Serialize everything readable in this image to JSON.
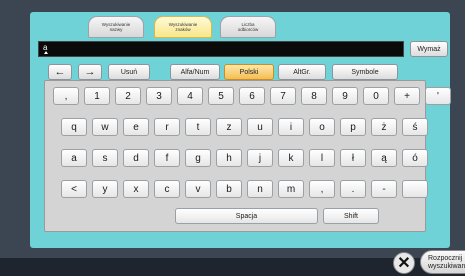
{
  "tabs": [
    {
      "line1": "Wyszukiwanie",
      "line2": "nazwy"
    },
    {
      "line1": "Wyszukiwanie",
      "line2": "znaków"
    },
    {
      "line1": "Liczba",
      "line2": "odbiorców"
    }
  ],
  "search": {
    "value": "a"
  },
  "clear_label": "Wymaż",
  "toolbar": {
    "left_arrow": "←",
    "right_arrow": "→",
    "delete": "Usuń",
    "alfanum": "Alfa/Num",
    "polski": "Polski",
    "altgr": "AltGr.",
    "symbols": "Symbole"
  },
  "keys": {
    "row1": [
      ",",
      "1",
      "2",
      "3",
      "4",
      "5",
      "6",
      "7",
      "8",
      "9",
      "0",
      "+",
      "'"
    ],
    "row2": [
      "q",
      "w",
      "e",
      "r",
      "t",
      "z",
      "u",
      "i",
      "o",
      "p",
      "ż",
      "ś"
    ],
    "row3": [
      "a",
      "s",
      "d",
      "f",
      "g",
      "h",
      "j",
      "k",
      "l",
      "ł",
      "ą",
      "ó"
    ],
    "row4": [
      "<",
      "y",
      "x",
      "c",
      "v",
      "b",
      "n",
      "m",
      ",",
      ".",
      "-",
      ""
    ],
    "space": "Spacja",
    "shift": "Shift"
  },
  "cancel_icon": "close-icon",
  "start_search": {
    "line1": "Rozpocznij",
    "line2": "wyszukiwanie"
  },
  "colors": {
    "panel": "#6fd2d6",
    "selected": "#f4bd55",
    "active_tab": "#f8e78a"
  }
}
